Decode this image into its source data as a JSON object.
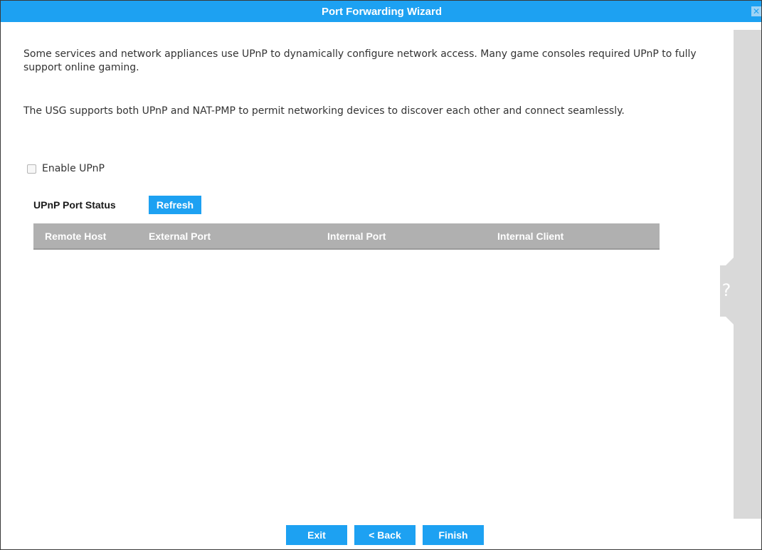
{
  "window": {
    "title": "Port Forwarding Wizard",
    "close_icon": "close-icon"
  },
  "intro": {
    "paragraph1": "Some services and network appliances use UPnP to dynamically configure network access. Many game consoles required UPnP to fully support online gaming.",
    "paragraph2": "The USG supports both UPnP and NAT-PMP to permit networking devices to discover each other and connect seamlessly."
  },
  "enable_upnp": {
    "label": "Enable UPnP",
    "checked": false
  },
  "status": {
    "label": "UPnP Port Status",
    "refresh_label": "Refresh"
  },
  "table": {
    "columns": [
      "Remote Host",
      "External Port",
      "Internal Port",
      "Internal Client"
    ],
    "rows": []
  },
  "help": {
    "icon": "help-icon"
  },
  "footer": {
    "exit_label": "Exit",
    "back_label": "< Back",
    "finish_label": "Finish"
  },
  "colors": {
    "accent": "#1da1f2",
    "table_header": "#b0b0b0",
    "side_panel": "#d9d9d9"
  }
}
